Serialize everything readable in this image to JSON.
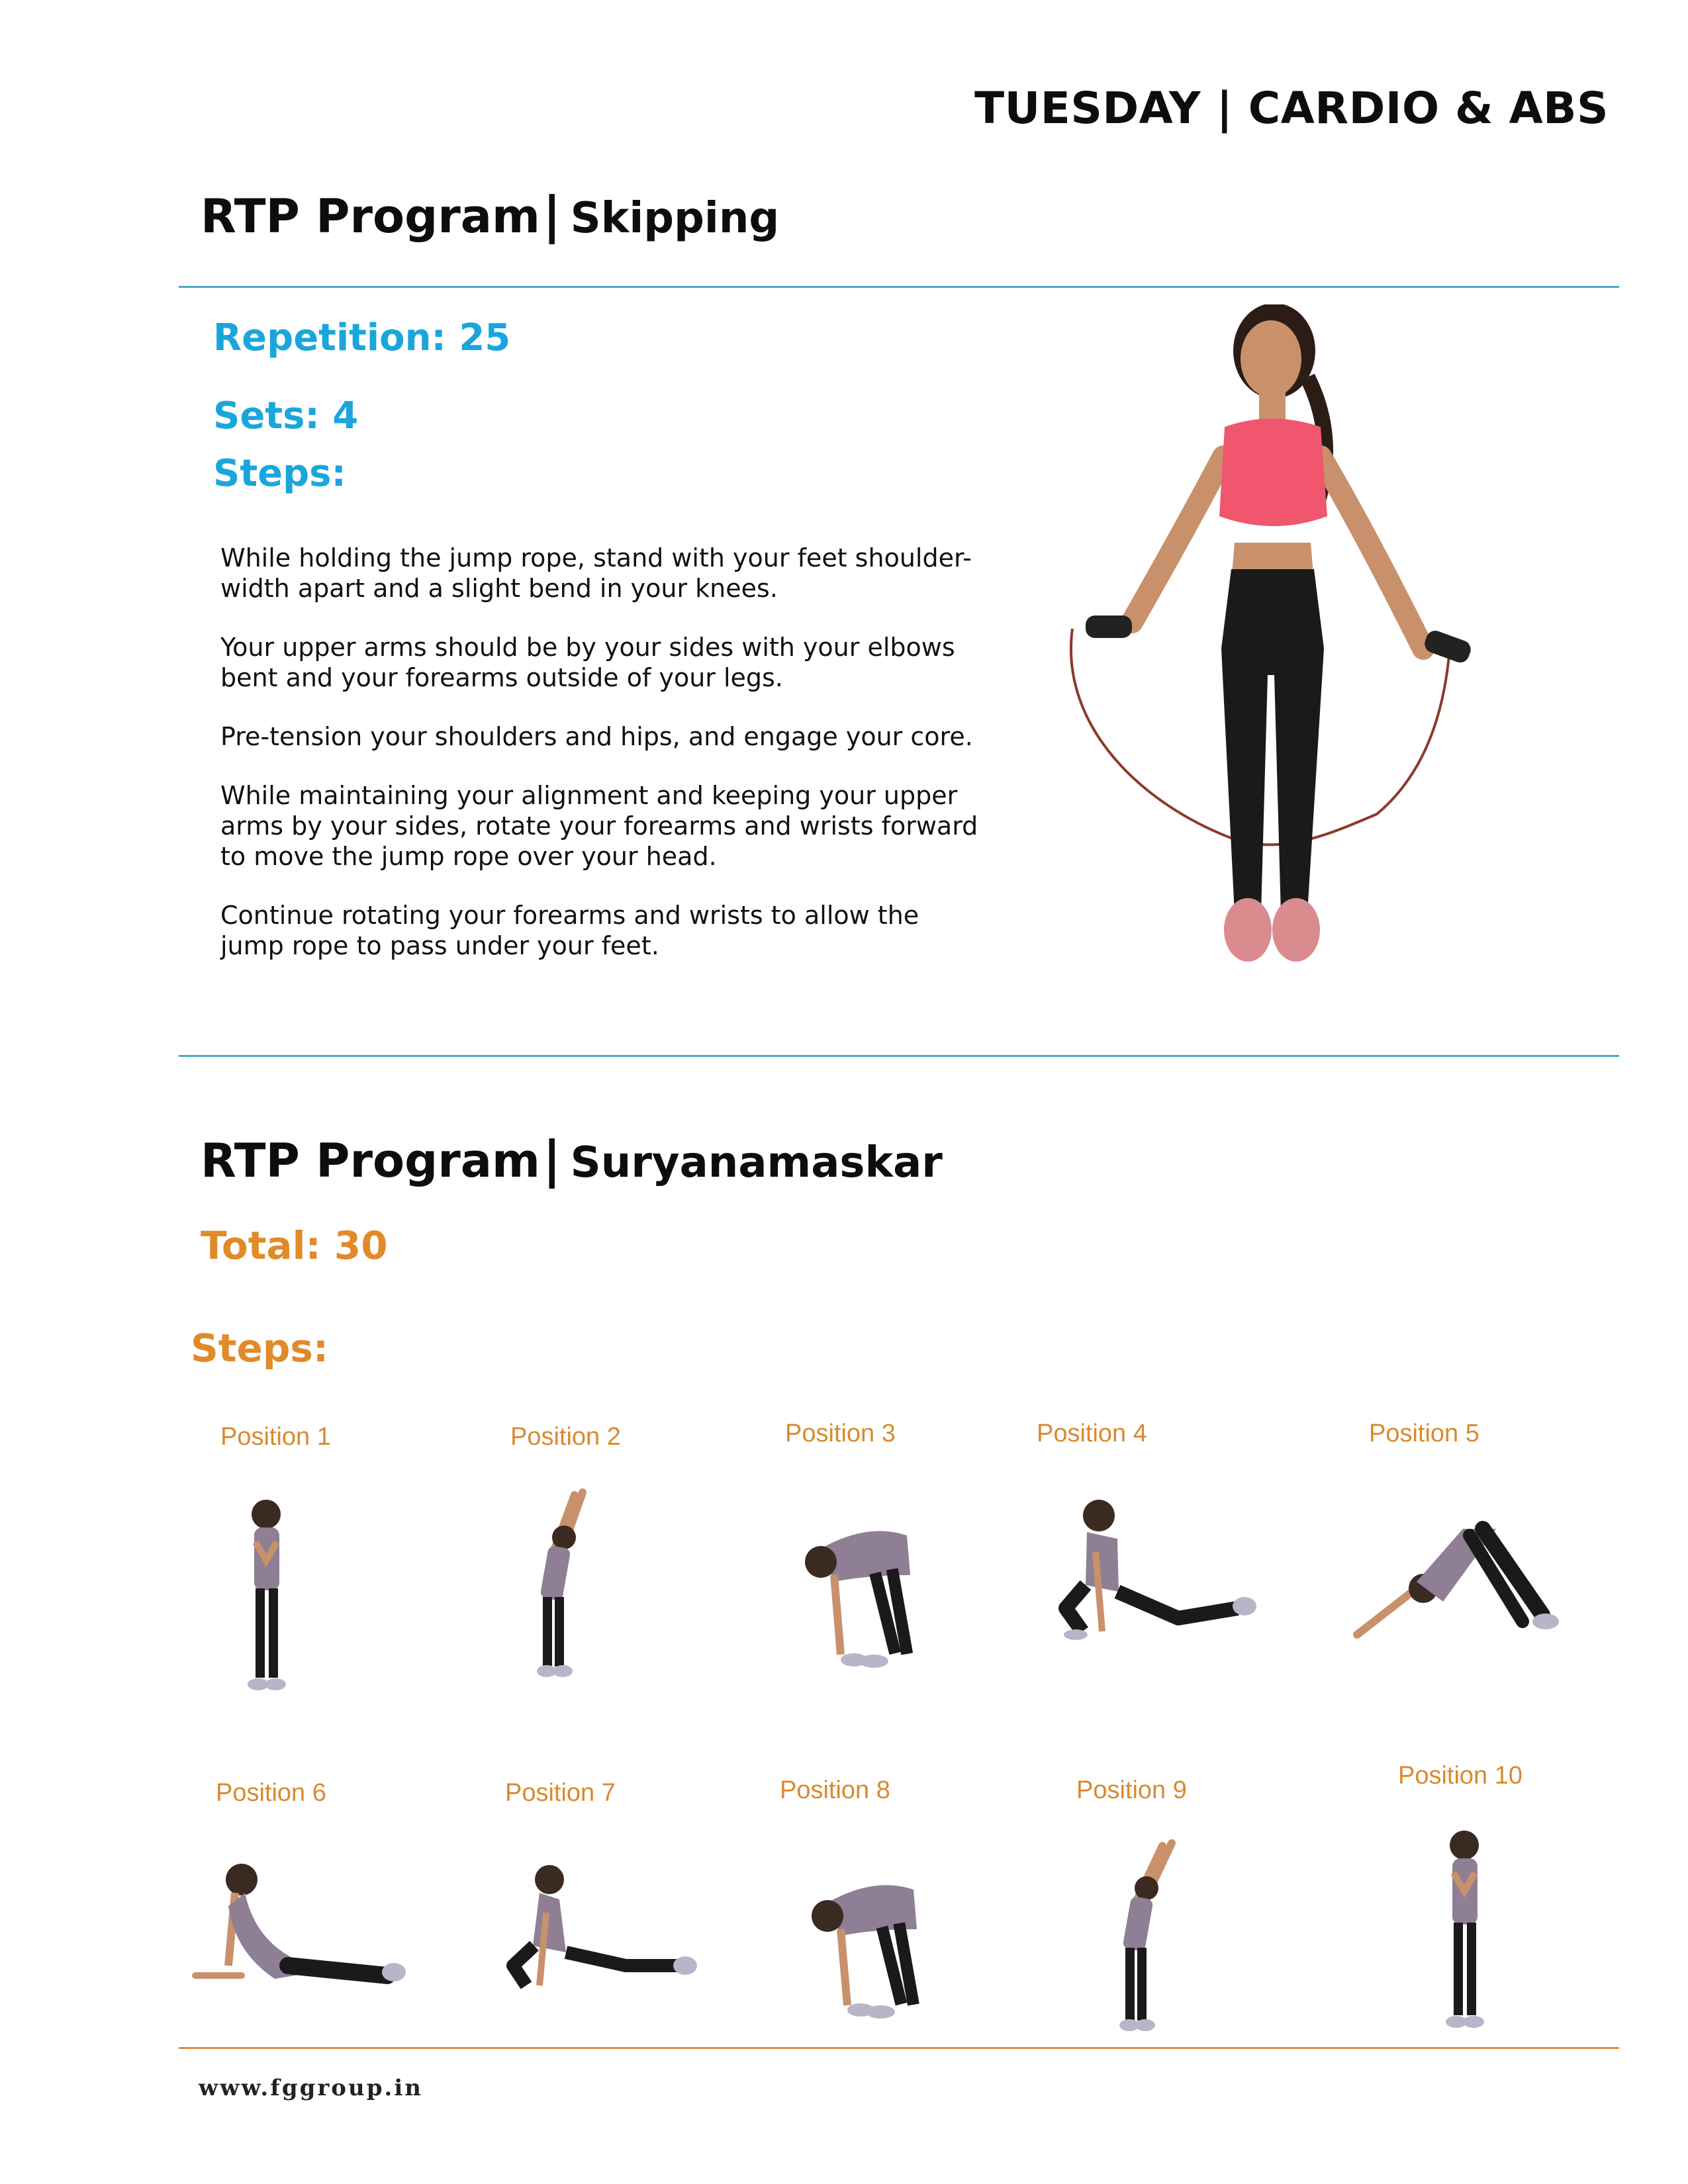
{
  "header": {
    "day_title": "TUESDAY | CARDIO & ABS"
  },
  "skipping": {
    "program_label": "RTP Program",
    "separator": "|",
    "exercise": "Skipping",
    "repetition": "Repetition: 25",
    "sets": "Sets: 4",
    "steps_label": "Steps:",
    "steps": [
      "While holding the jump rope, stand with your feet shoulder-width apart and a slight bend in your knees.",
      "Your upper arms should be by your sides with your elbows bent and your forearms outside of your legs.",
      "Pre-tension your shoulders and hips, and engage your core.",
      "While maintaining your alignment and keeping your upper arms by your sides, rotate your forearms and wrists forward to move the jump rope over your head.",
      "Continue rotating your forearms and wrists to allow the jump rope to pass under your feet."
    ]
  },
  "suryanamaskar": {
    "program_label": "RTP Program",
    "separator": "|",
    "exercise": "Suryanamaskar",
    "total": "Total: 30",
    "steps_label": "Steps:",
    "positions": [
      "Position 1",
      "Position 2",
      "Position 3",
      "Position 4",
      "Position 5",
      "Position 6",
      "Position 7",
      "Position 8",
      "Position 9",
      "Position 10"
    ]
  },
  "footer": {
    "url": "www.fggroup.in"
  },
  "colors": {
    "accent_blue": "#1aa6dc",
    "accent_orange": "#e08a2a",
    "rule_blue": "#4aa9c7",
    "rule_orange": "#e08a3a",
    "top_pink": "#f0566e",
    "leggings": "#1a1a1a",
    "tank_mauve": "#8e7f95",
    "rope_brown": "#8b3a2a"
  }
}
